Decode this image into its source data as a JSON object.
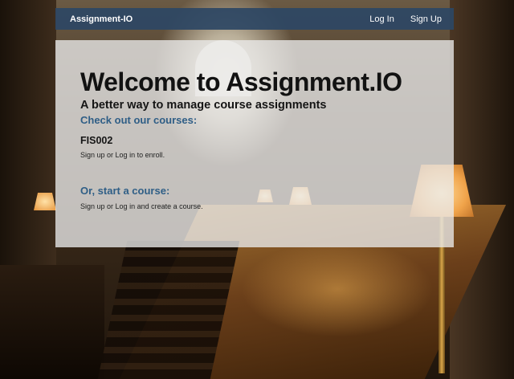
{
  "navbar": {
    "brand": "Assignment-IO",
    "login": "Log In",
    "signup": "Sign Up"
  },
  "hero": {
    "title": "Welcome to Assignment.IO",
    "subtitle": "A better way to manage course assignments"
  },
  "courses": {
    "heading": "Check out our courses:",
    "code": "FIS002",
    "signup_link": "Sign up",
    "or": " or ",
    "login_link": "Log in",
    "suffix": " to enroll."
  },
  "start": {
    "heading": "Or, start a course:",
    "signup_link": "Sign up",
    "or": " or ",
    "login_link": "Log in",
    "suffix": " and create a course."
  },
  "colors": {
    "navbar": "#2d4664",
    "heading_blue": "#2f5e86"
  }
}
